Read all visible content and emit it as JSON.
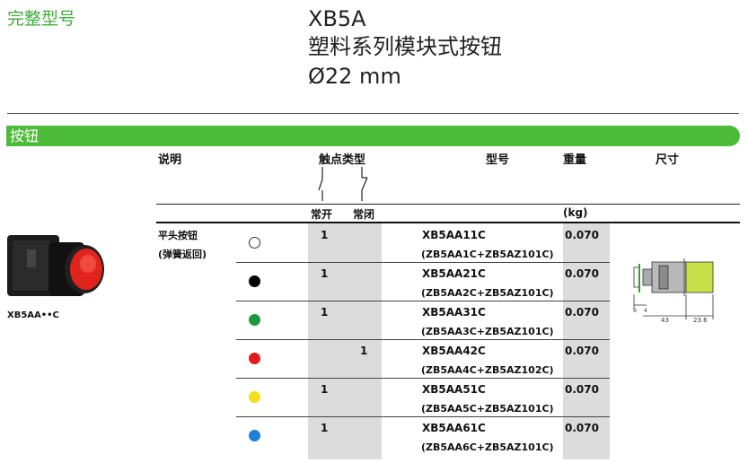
{
  "header": {
    "subtitle": "完整型号",
    "title_line1": "XB5A",
    "title_line2": "塑料系列模块式按钮",
    "title_line3": "Ø22 mm"
  },
  "section": {
    "label": "按钮"
  },
  "table": {
    "headers": {
      "description": "说明",
      "contact_type": "触点类型",
      "model": "型号",
      "weight": "重量",
      "size": "尺寸"
    },
    "subheaders": {
      "no": "常开",
      "nc": "常闭",
      "weight_unit": "(kg)"
    },
    "description": {
      "line1": "平头按钮",
      "line2": "(弹簧返回)"
    },
    "product_label": "XB5AA••C",
    "rows": [
      {
        "color": "#ffffff",
        "no": "1",
        "nc": "",
        "model": "XB5AA11C",
        "parts": "(ZB5AA1C+ZB5AZ101C)",
        "weight": "0.070"
      },
      {
        "color": "#000000",
        "no": "1",
        "nc": "",
        "model": "XB5AA21C",
        "parts": "(ZB5AA2C+ZB5AZ101C)",
        "weight": "0.070"
      },
      {
        "color": "#1a9a3a",
        "no": "1",
        "nc": "",
        "model": "XB5AA31C",
        "parts": "(ZB5AA3C+ZB5AZ101C)",
        "weight": "0.070"
      },
      {
        "color": "#e01b1b",
        "no": "",
        "nc": "1",
        "model": "XB5AA42C",
        "parts": "(ZB5AA4C+ZB5AZ102C)",
        "weight": "0.070"
      },
      {
        "color": "#f2e01a",
        "no": "1",
        "nc": "",
        "model": "XB5AA51C",
        "parts": "(ZB5AA5C+ZB5AZ101C)",
        "weight": "0.070"
      },
      {
        "color": "#1e7fd6",
        "no": "1",
        "nc": "",
        "model": "XB5AA61C",
        "parts": "(ZB5AA6C+ZB5AZ101C)",
        "weight": "0.070"
      }
    ]
  },
  "drawing": {
    "dim_a": "9",
    "dim_b": "4",
    "dim_c": "43",
    "dim_d": "23.6"
  }
}
